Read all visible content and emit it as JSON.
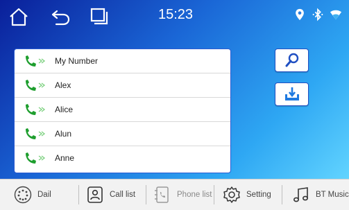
{
  "status_bar": {
    "time": "15:23",
    "icons": [
      "home-icon",
      "back-icon",
      "recent-apps-icon",
      "location-icon",
      "bluetooth-icon",
      "wifi-icon"
    ]
  },
  "contacts": [
    {
      "name": "My Number"
    },
    {
      "name": "Alex"
    },
    {
      "name": "Alice"
    },
    {
      "name": "Alun"
    },
    {
      "name": "Anne"
    }
  ],
  "actions": {
    "search_icon": "search-icon",
    "download_icon": "download-icon"
  },
  "bottom_nav": [
    {
      "label": "Dail",
      "icon": "dialpad-icon"
    },
    {
      "label": "Call list",
      "icon": "person-icon"
    },
    {
      "label": "Phone list",
      "icon": "phone-list-icon"
    },
    {
      "label": "Setting",
      "icon": "gear-icon"
    },
    {
      "label": "BT Music",
      "icon": "music-note-icon"
    }
  ],
  "colors": {
    "accent": "#1f4fc2",
    "phone_green": "#1e9e2e",
    "download_blue": "#1f7ae0"
  }
}
